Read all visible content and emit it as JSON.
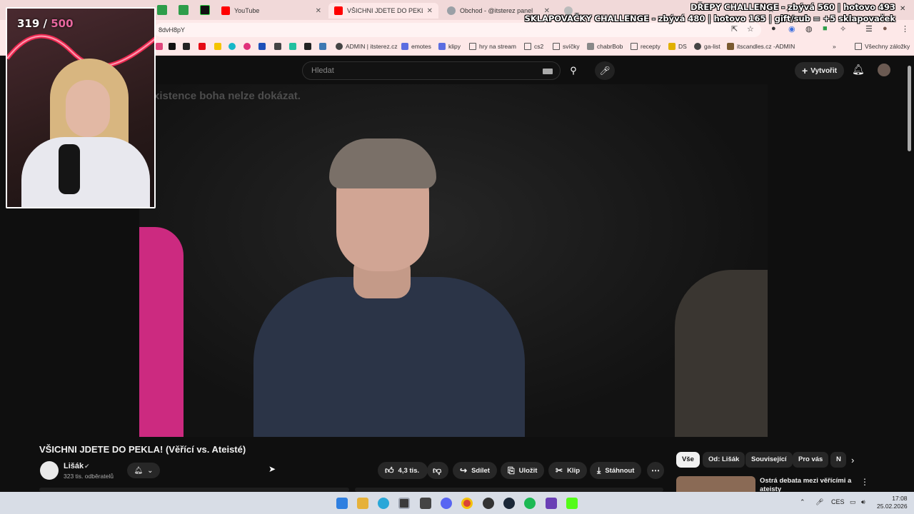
{
  "browser": {
    "tabs": [
      {
        "label": "YouTube",
        "color": "#ff0000"
      },
      {
        "label": "VŠICHNI JDETE DO PEKLA! (Věř",
        "color": "#ff0000"
      },
      {
        "label": "Obchod - @itsterez panel",
        "color": "#9aa0a6"
      }
    ],
    "address": "8dvH8pY",
    "bookmarks": [
      {
        "label": "ADMIN | itsterez.cz",
        "color": "#444444"
      },
      {
        "label": "emotes",
        "color": "#5b6ee1"
      },
      {
        "label": "klipy",
        "color": "#5b6ee1"
      },
      {
        "label": "hry na stream",
        "color": "folder"
      },
      {
        "label": "cs2",
        "color": "folder"
      },
      {
        "label": "svíčky",
        "color": "folder"
      },
      {
        "label": "chabrBob",
        "color": "#888888"
      },
      {
        "label": "recepty",
        "color": "folder"
      },
      {
        "label": "DS",
        "color": "#e0b000"
      },
      {
        "label": "ga-list",
        "color": "#444444"
      },
      {
        "label": "itscandles.cz -ADMIN",
        "color": "#7a5a30"
      },
      {
        "label": "Všechny záložky",
        "color": "folder"
      }
    ],
    "more_bookmarks": "»"
  },
  "overlay": {
    "counter_current": "319",
    "counter_sep": " / ",
    "counter_max": "500",
    "challenge_line1": "DŘEPY CHALLENGE - zbývá 560 | hotovo 493",
    "challenge_line2": "SKLAPOVAČKY CHALLENGE - zbývá 480 | hotovo 165 | gift/sub = +5 sklapovaček"
  },
  "youtube": {
    "search_placeholder": "Hledat",
    "create_label": "Vytvořit",
    "video_caption": "xistence boha nelze dokázat.",
    "title": "VŠICHNI JDETE DO PEKLA! (Věřící vs. Ateisté)",
    "channel": "Lišák",
    "subscribers": "323 tis. odběratelů",
    "likes": "4,3 tis.",
    "actions": {
      "share": "Sdílet",
      "save": "Uložit",
      "clip": "Klip",
      "download": "Stáhnout"
    },
    "chips": [
      "Vše",
      "Od: Lišák",
      "Související",
      "Pro vás",
      "N"
    ],
    "recommended_title": "Ostrá debata mezi věřícími a ateisty"
  },
  "taskbar": {
    "language": "CES",
    "time": "17:08",
    "date": "25.02.2026"
  }
}
